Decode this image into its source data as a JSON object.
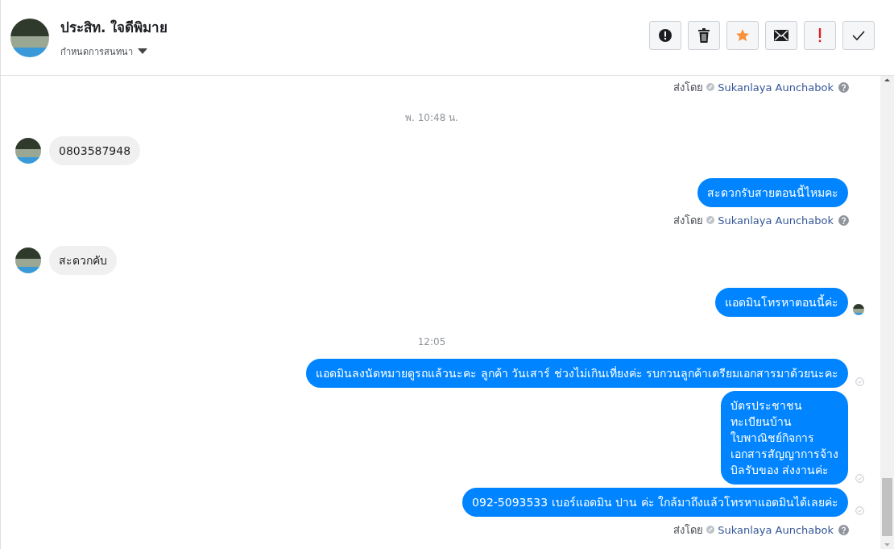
{
  "header": {
    "name": "ประสิท. ใจดีพิมาย",
    "subtitle": "กำหนดการสนทนา",
    "starred": true
  },
  "messages": [
    {
      "kind": "sent_by",
      "label": "ส่งโดย",
      "agent": "Sukanlaya Aunchabok"
    },
    {
      "kind": "timestamp",
      "text": "พ. 10:48 น."
    },
    {
      "kind": "incoming",
      "text": "0803587948"
    },
    {
      "kind": "outgoing",
      "text": "สะดวกรับสายตอนนี้ไหมคะ",
      "seen": false,
      "delivered": false
    },
    {
      "kind": "sent_by",
      "label": "ส่งโดย",
      "agent": "Sukanlaya Aunchabok"
    },
    {
      "kind": "incoming",
      "text": "สะดวกคับ"
    },
    {
      "kind": "outgoing",
      "text": "แอดมินโทรหาตอนนี้ค่ะ",
      "seen": true,
      "delivered": false
    },
    {
      "kind": "timestamp",
      "text": "12:05"
    },
    {
      "kind": "outgoing",
      "text": "แอดมินลงนัดหมายดูรถแล้วนะคะ ลูกค้า วันเสาร์ ช่วงไม่เกินเที่ยงค่ะ  รบกวนลูกค้าเตรียมเอกสารมาด้วยนะคะ",
      "seen": false,
      "delivered": true
    },
    {
      "kind": "outgoing",
      "text": "บัตรประชาชน\nทะเบียนบ้าน\nใบพาณิชย์กิจการ\nเอกสารสัญญาการจ้าง\nบิลรับของ ส่งงานค่ะ",
      "seen": false,
      "delivered": true
    },
    {
      "kind": "outgoing",
      "text": "092-5093533  เบอร์แอดมิน ปาน ค่ะ ใกล้มาถึงแล้วโทรหาแอดมินได้เลยค่ะ",
      "seen": false,
      "delivered": true
    },
    {
      "kind": "sent_by",
      "label": "ส่งโดย",
      "agent": "Sukanlaya Aunchabok"
    }
  ]
}
